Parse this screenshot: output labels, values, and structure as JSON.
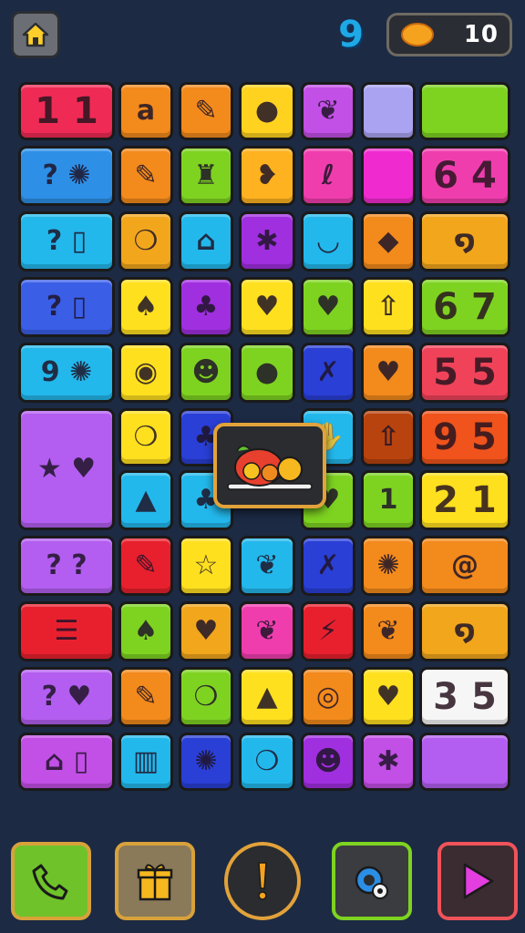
{
  "topbar": {
    "home_icon": "home-icon",
    "logo_text": "9",
    "coin_icon": "coin-icon",
    "coin_value": "10"
  },
  "colors": {
    "background": "#1c2a44",
    "popup_border": "#e2a23a"
  },
  "tiles": [
    {
      "name": "tile-1-1",
      "color": "#ef2b55",
      "text": "11",
      "kind": "num"
    },
    {
      "name": "tile-a",
      "color": "#f38a1c",
      "text": "a",
      "kind": "glyph"
    },
    {
      "name": "tile-pencil-1",
      "color": "#f38a1c",
      "text": "✎",
      "kind": "glyph"
    },
    {
      "name": "tile-apple",
      "color": "#ffd21f",
      "text": "●",
      "kind": "glyph"
    },
    {
      "name": "tile-leaf-1",
      "color": "#c24fe6",
      "text": "❦",
      "kind": "glyph"
    },
    {
      "name": "tile-blank-lavender",
      "color": "#a9a3f2",
      "text": "",
      "kind": "glyph"
    },
    {
      "name": "tile-blank-green",
      "color": "#7ed321",
      "text": "",
      "kind": "glyph"
    },
    {
      "name": "tile-question-jelly",
      "color": "#2e8fe6",
      "text": "? ✺",
      "kind": "glyph"
    },
    {
      "name": "tile-pencil-2",
      "color": "#f38a1c",
      "text": "✎",
      "kind": "glyph"
    },
    {
      "name": "tile-bottle",
      "color": "#7ed321",
      "text": "♜",
      "kind": "glyph"
    },
    {
      "name": "tile-chick",
      "color": "#ffb21f",
      "text": "❥",
      "kind": "glyph"
    },
    {
      "name": "tile-curl",
      "color": "#f03dae",
      "text": "ℓ",
      "kind": "glyph"
    },
    {
      "name": "tile-blank-magenta",
      "color": "#ef2bd0",
      "text": "",
      "kind": "glyph"
    },
    {
      "name": "tile-6-4",
      "color": "#f03dae",
      "text": "64",
      "kind": "num"
    },
    {
      "name": "tile-question-phone",
      "color": "#23b8ec",
      "text": "? ▯",
      "kind": "glyph"
    },
    {
      "name": "tile-bubble",
      "color": "#f2a61c",
      "text": "❍",
      "kind": "glyph"
    },
    {
      "name": "tile-robot",
      "color": "#23b8ec",
      "text": "⌂",
      "kind": "glyph"
    },
    {
      "name": "tile-splat",
      "color": "#a02fe0",
      "text": "✱",
      "kind": "glyph"
    },
    {
      "name": "tile-cup",
      "color": "#23b8ec",
      "text": "◡",
      "kind": "glyph"
    },
    {
      "name": "tile-diamond",
      "color": "#f38a1c",
      "text": "◆",
      "kind": "glyph"
    },
    {
      "name": "tile-spiral-1",
      "color": "#f2a61c",
      "text": "໑",
      "kind": "glyph"
    },
    {
      "name": "tile-question-phone-2",
      "color": "#3a5ee6",
      "text": "? ▯",
      "kind": "glyph"
    },
    {
      "name": "tile-pear",
      "color": "#ffe01f",
      "text": "♠",
      "kind": "glyph"
    },
    {
      "name": "tile-tree",
      "color": "#a02fe0",
      "text": "♣",
      "kind": "glyph"
    },
    {
      "name": "tile-heart-yellow",
      "color": "#ffe01f",
      "text": "♥",
      "kind": "glyph"
    },
    {
      "name": "tile-heart-red",
      "color": "#7ed321",
      "text": "♥",
      "kind": "glyph"
    },
    {
      "name": "tile-arrow-up",
      "color": "#ffe01f",
      "text": "⇧",
      "kind": "glyph"
    },
    {
      "name": "tile-6-7",
      "color": "#7ed321",
      "text": "67",
      "kind": "num"
    },
    {
      "name": "tile-9-jelly",
      "color": "#23b8ec",
      "text": "9 ✺",
      "kind": "glyph"
    },
    {
      "name": "tile-ring",
      "color": "#ffe01f",
      "text": "◉",
      "kind": "glyph"
    },
    {
      "name": "tile-strawberry",
      "color": "#7ed321",
      "text": "☻",
      "kind": "glyph"
    },
    {
      "name": "tile-lemon",
      "color": "#7ed321",
      "text": "●",
      "kind": "glyph"
    },
    {
      "name": "tile-dancer",
      "color": "#2a3fd6",
      "text": "✗",
      "kind": "glyph"
    },
    {
      "name": "tile-heart-orange",
      "color": "#f38a1c",
      "text": "♥",
      "kind": "glyph"
    },
    {
      "name": "tile-5-5",
      "color": "#f0435a",
      "text": "55",
      "kind": "num"
    },
    {
      "name": "tile-stars-heart",
      "color": "#b35ef0",
      "text": "★ ♥",
      "kind": "glyph"
    },
    {
      "name": "tile-bubble-2",
      "color": "#ffe01f",
      "text": "❍",
      "kind": "glyph"
    },
    {
      "name": "tile-tree-2",
      "color": "#2a3fd6",
      "text": "♣",
      "kind": "glyph"
    },
    {
      "name": "tile-hand",
      "color": "#23b8ec",
      "text": "✋",
      "kind": "glyph"
    },
    {
      "name": "tile-arrow-up-2",
      "color": "#b8430e",
      "text": "⇧",
      "kind": "glyph"
    },
    {
      "name": "tile-9-5",
      "color": "#f0531c",
      "text": "95",
      "kind": "num"
    },
    {
      "name": "tile-shirt",
      "color": "#23b8ec",
      "text": "▲",
      "kind": "glyph"
    },
    {
      "name": "tile-tree-3",
      "color": "#23b8ec",
      "text": "♣",
      "kind": "glyph"
    },
    {
      "name": "tile-heart-green",
      "color": "#7ed321",
      "text": "♥",
      "kind": "glyph"
    },
    {
      "name": "tile-1",
      "color": "#7ed321",
      "text": "1",
      "kind": "glyph"
    },
    {
      "name": "tile-2-1",
      "color": "#ffe01f",
      "text": "21",
      "kind": "num"
    },
    {
      "name": "tile-question-question",
      "color": "#b35ef0",
      "text": "? ?",
      "kind": "glyph"
    },
    {
      "name": "tile-pencil-red",
      "color": "#e8202e",
      "text": "✎",
      "kind": "glyph"
    },
    {
      "name": "tile-star",
      "color": "#ffe01f",
      "text": "☆",
      "kind": "glyph"
    },
    {
      "name": "tile-bird",
      "color": "#23b8ec",
      "text": "❦",
      "kind": "glyph"
    },
    {
      "name": "tile-dancer-2",
      "color": "#2a3fd6",
      "text": "✗",
      "kind": "glyph"
    },
    {
      "name": "tile-monster",
      "color": "#f38a1c",
      "text": "✺",
      "kind": "glyph"
    },
    {
      "name": "tile-swirl",
      "color": "#f38a1c",
      "text": "@",
      "kind": "glyph"
    },
    {
      "name": "tile-burger",
      "color": "#e8202e",
      "text": "☰",
      "kind": "glyph"
    },
    {
      "name": "tile-pear-2",
      "color": "#7ed321",
      "text": "♠",
      "kind": "glyph"
    },
    {
      "name": "tile-heart-yellow-2",
      "color": "#f2a61c",
      "text": "♥",
      "kind": "glyph"
    },
    {
      "name": "tile-leaf-pink",
      "color": "#f03dae",
      "text": "❦",
      "kind": "glyph"
    },
    {
      "name": "tile-bolt",
      "color": "#e8202e",
      "text": "⚡",
      "kind": "glyph"
    },
    {
      "name": "tile-leaf-green",
      "color": "#f38a1c",
      "text": "❦",
      "kind": "glyph"
    },
    {
      "name": "tile-spiral-2",
      "color": "#f2a61c",
      "text": "໑",
      "kind": "glyph"
    },
    {
      "name": "tile-question-heart",
      "color": "#b35ef0",
      "text": "? ♥",
      "kind": "glyph"
    },
    {
      "name": "tile-pencil-3",
      "color": "#f38a1c",
      "text": "✎",
      "kind": "glyph"
    },
    {
      "name": "tile-bubble-3",
      "color": "#7ed321",
      "text": "❍",
      "kind": "glyph"
    },
    {
      "name": "tile-cheese",
      "color": "#ffe01f",
      "text": "▲",
      "kind": "glyph"
    },
    {
      "name": "tile-square-ring",
      "color": "#f38a1c",
      "text": "◎",
      "kind": "glyph"
    },
    {
      "name": "tile-heart-red-2",
      "color": "#ffe01f",
      "text": "♥",
      "kind": "glyph"
    },
    {
      "name": "tile-3-5",
      "color": "#f6f6f6",
      "text": "35",
      "kind": "num"
    },
    {
      "name": "tile-robot-phone",
      "color": "#c24fe6",
      "text": "⌂ ▯",
      "kind": "glyph"
    },
    {
      "name": "tile-bin",
      "color": "#23b8ec",
      "text": "▥",
      "kind": "glyph"
    },
    {
      "name": "tile-virus",
      "color": "#2a3fd6",
      "text": "✺",
      "kind": "glyph"
    },
    {
      "name": "tile-bubble-4",
      "color": "#23b8ec",
      "text": "❍",
      "kind": "glyph"
    },
    {
      "name": "tile-strawberry-2",
      "color": "#a02fe0",
      "text": "☻",
      "kind": "glyph"
    },
    {
      "name": "tile-splat-2",
      "color": "#c24fe6",
      "text": "✱",
      "kind": "glyph"
    },
    {
      "name": "tile-blank-purple",
      "color": "#b35ef0",
      "text": "",
      "kind": "glyph"
    }
  ],
  "popup": {
    "icon": "food-plate-icon"
  },
  "bottombar": {
    "buttons": [
      {
        "name": "phone-button",
        "icon": "phone-icon",
        "bg": "#7ed321",
        "border": "#e2a23a"
      },
      {
        "name": "gift-button",
        "icon": "gift-icon",
        "bg": "#8a7a5a",
        "border": "#e2a23a"
      },
      {
        "name": "hint-button",
        "icon": "exclamation-icon",
        "bg": "#2a2c30",
        "border": "#e2a23a"
      },
      {
        "name": "settings-button",
        "icon": "gear-icon",
        "bg": "#3a3c40",
        "border": "#7ed321"
      },
      {
        "name": "play-button",
        "icon": "play-icon",
        "bg": "#3a2c30",
        "border": "#f0535a"
      }
    ]
  }
}
